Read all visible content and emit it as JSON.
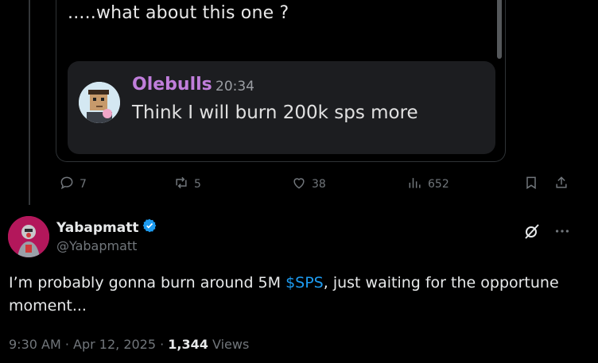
{
  "embed": {
    "top_text": ".....what about this one ?",
    "message": {
      "author": "Olebulls",
      "time": "20:34",
      "body": "Think I will burn 200k sps more"
    }
  },
  "actions": {
    "replies": "7",
    "reposts": "5",
    "likes": "38",
    "views": "652"
  },
  "tweet": {
    "display_name": "Yabapmatt",
    "handle": "@Yabapmatt",
    "verified_color": "#1d9bf0",
    "text_before": "I’m probably gonna burn around 5M ",
    "cashtag": "$SPS",
    "text_after": ", just waiting for the opportune moment...",
    "timestamp": "9:30 AM · Apr 12, 2025 · ",
    "views_count": "1,344",
    "views_label": " Views"
  },
  "colors": {
    "accent": "#1d9bf0",
    "muted": "#71767b",
    "discord_name": "#c07edb"
  }
}
